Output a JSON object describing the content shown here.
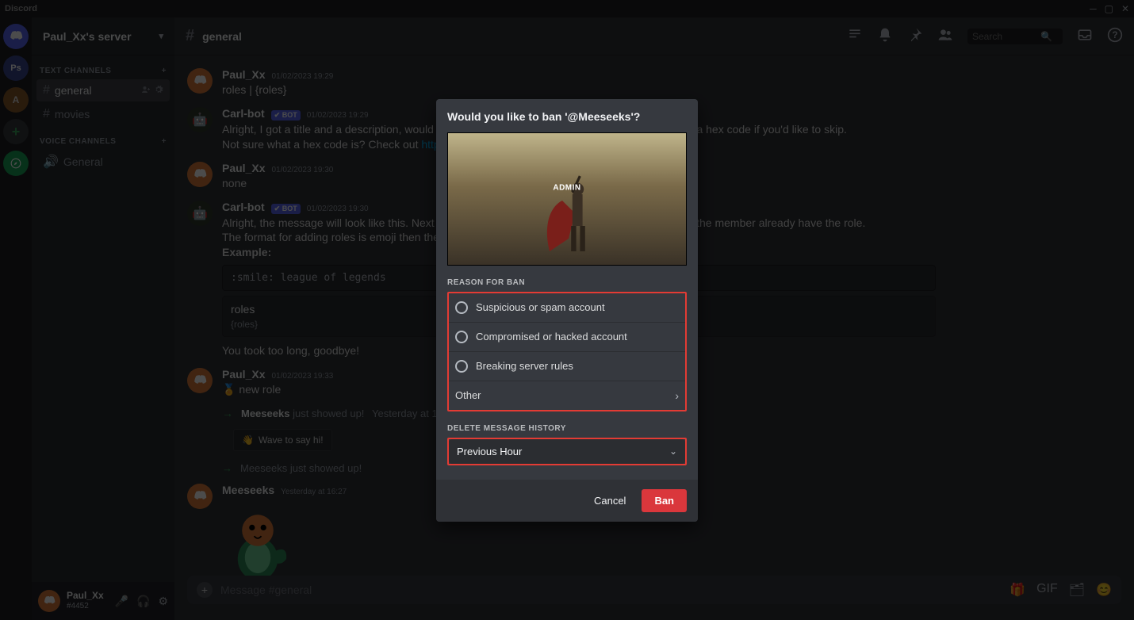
{
  "titlebar": {
    "app_name": "Discord"
  },
  "server": {
    "name": "Paul_Xx's server"
  },
  "sidebar": {
    "text_section": "TEXT CHANNELS",
    "voice_section": "VOICE CHANNELS",
    "text_channels": [
      {
        "name": "general",
        "selected": true
      },
      {
        "name": "movies",
        "selected": false
      }
    ],
    "voice_channels": [
      {
        "name": "General"
      }
    ]
  },
  "user": {
    "name": "Paul_Xx",
    "tag": "#4452"
  },
  "channel_header": {
    "name": "general",
    "search_placeholder": "Search"
  },
  "messages": [
    {
      "type": "user",
      "author": "Paul_Xx",
      "timestamp": "01/02/2023 19:29",
      "content_lines": [
        "roles | {roles}"
      ]
    },
    {
      "type": "bot",
      "author": "Carl-bot",
      "bot_tag": "✔ BOT",
      "timestamp": "01/02/2023 19:29",
      "content_lines": [
        "Alright, I got a title and a description, would you like the message to have a color? Respond with a hex code if you'd like to skip.",
        "Not sure what a hex code is? Check out "
      ],
      "link_text": "https://htmlcolorcodes.com/"
    },
    {
      "type": "user",
      "author": "Paul_Xx",
      "timestamp": "01/02/2023 19:30",
      "content_lines": [
        "none"
      ]
    },
    {
      "type": "bot",
      "author": "Carl-bot",
      "bot_tag": "✔ BOT",
      "timestamp": "01/02/2023 19:30",
      "content_lines": [
        "Alright, the message will look like this. Next up we will add roles. The bot will remove reactions if the member already have the role.",
        "The format for adding roles is emoji then the name of the role. Send 'done' when you're done."
      ],
      "example_label": "Example:",
      "code": ":smile: league of legends",
      "roles_title": "roles",
      "roles_sub": "{roles}",
      "timeout": "You took too long, goodbye!"
    },
    {
      "type": "user",
      "author": "Paul_Xx",
      "timestamp": "01/02/2023 19:33",
      "badge": "🏅",
      "content_lines": [
        "new role"
      ]
    },
    {
      "type": "join",
      "author": "Meeseeks",
      "join_text": "just showed up!",
      "timestamp": "Yesterday at 16:21",
      "wave_label": "Wave to say hi!"
    },
    {
      "type": "system",
      "arrow": "→",
      "text": "Meeseeks just showed up!"
    },
    {
      "type": "sticker",
      "author": "Meeseeks",
      "timestamp": "Yesterday at 16:27"
    }
  ],
  "composer": {
    "placeholder": "Message #general"
  },
  "modal": {
    "title": "Would you like to ban '@Meeseeks'?",
    "admin_label": "ADMIN",
    "reason_label": "REASON FOR BAN",
    "reasons": [
      "Suspicious or spam account",
      "Compromised or hacked account",
      "Breaking server rules"
    ],
    "other_label": "Other",
    "delete_label": "DELETE MESSAGE HISTORY",
    "delete_selected": "Previous Hour",
    "cancel": "Cancel",
    "ban": "Ban"
  }
}
